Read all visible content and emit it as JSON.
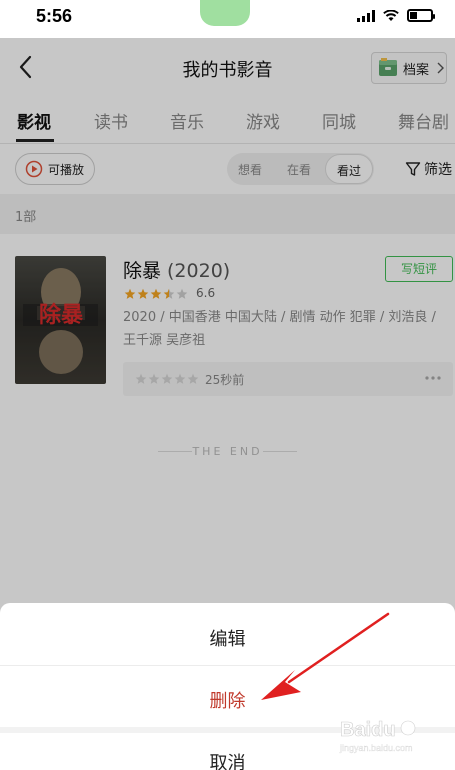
{
  "status_bar": {
    "time": "5:56"
  },
  "nav": {
    "title": "我的书影音",
    "archive_label": "档案"
  },
  "tabs": [
    "影视",
    "读书",
    "音乐",
    "游戏",
    "同城",
    "舞台剧"
  ],
  "filters": {
    "playable_label": "可播放",
    "segments": [
      "想看",
      "在看",
      "看过"
    ],
    "active_segment": "看过",
    "filter_label": "筛选"
  },
  "list": {
    "count_label": "1部"
  },
  "movie": {
    "title": "除暴",
    "year": "(2020)",
    "rating": "6.6",
    "stars": 3.5,
    "meta": "2020 / 中国香港 中国大陆 / 剧情 动作 犯罪 / 刘浩良 / 王千源 吴彦祖",
    "review_button": "写短评",
    "marked_time": "25秒前",
    "poster_title": "除暴"
  },
  "end_text": "THE END",
  "sheet": {
    "edit": "编辑",
    "delete": "删除",
    "cancel": "取消"
  },
  "colors": {
    "accent_green": "#42bd56",
    "delete_red": "#c0392b",
    "star_orange": "#f5a623"
  },
  "watermark": {
    "brand": "Baidu",
    "sub": "jingyan.baidu.com"
  }
}
